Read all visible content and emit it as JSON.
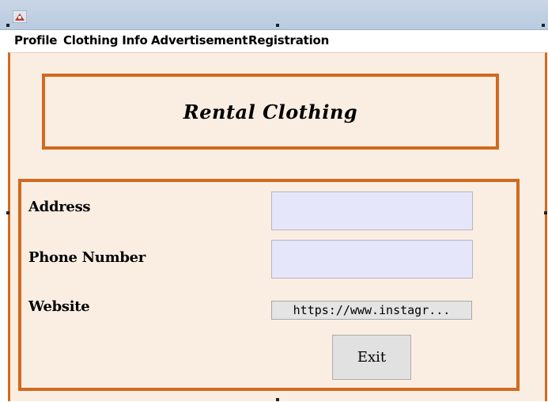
{
  "menu": {
    "items": [
      "Profile",
      "Clothing Info",
      "Advertisement",
      "Registration"
    ]
  },
  "header": {
    "title": "Rental Clothing"
  },
  "form": {
    "address_label": "Address",
    "address_value": "",
    "phone_label": "Phone Number",
    "phone_value": "",
    "website_label": "Website",
    "website_value": "https://www.instagr..."
  },
  "buttons": {
    "exit_label": "Exit"
  },
  "colors": {
    "accent_border": "#d2691e",
    "panel_background": "#faeee3",
    "input_background": "#e6e6fa"
  }
}
